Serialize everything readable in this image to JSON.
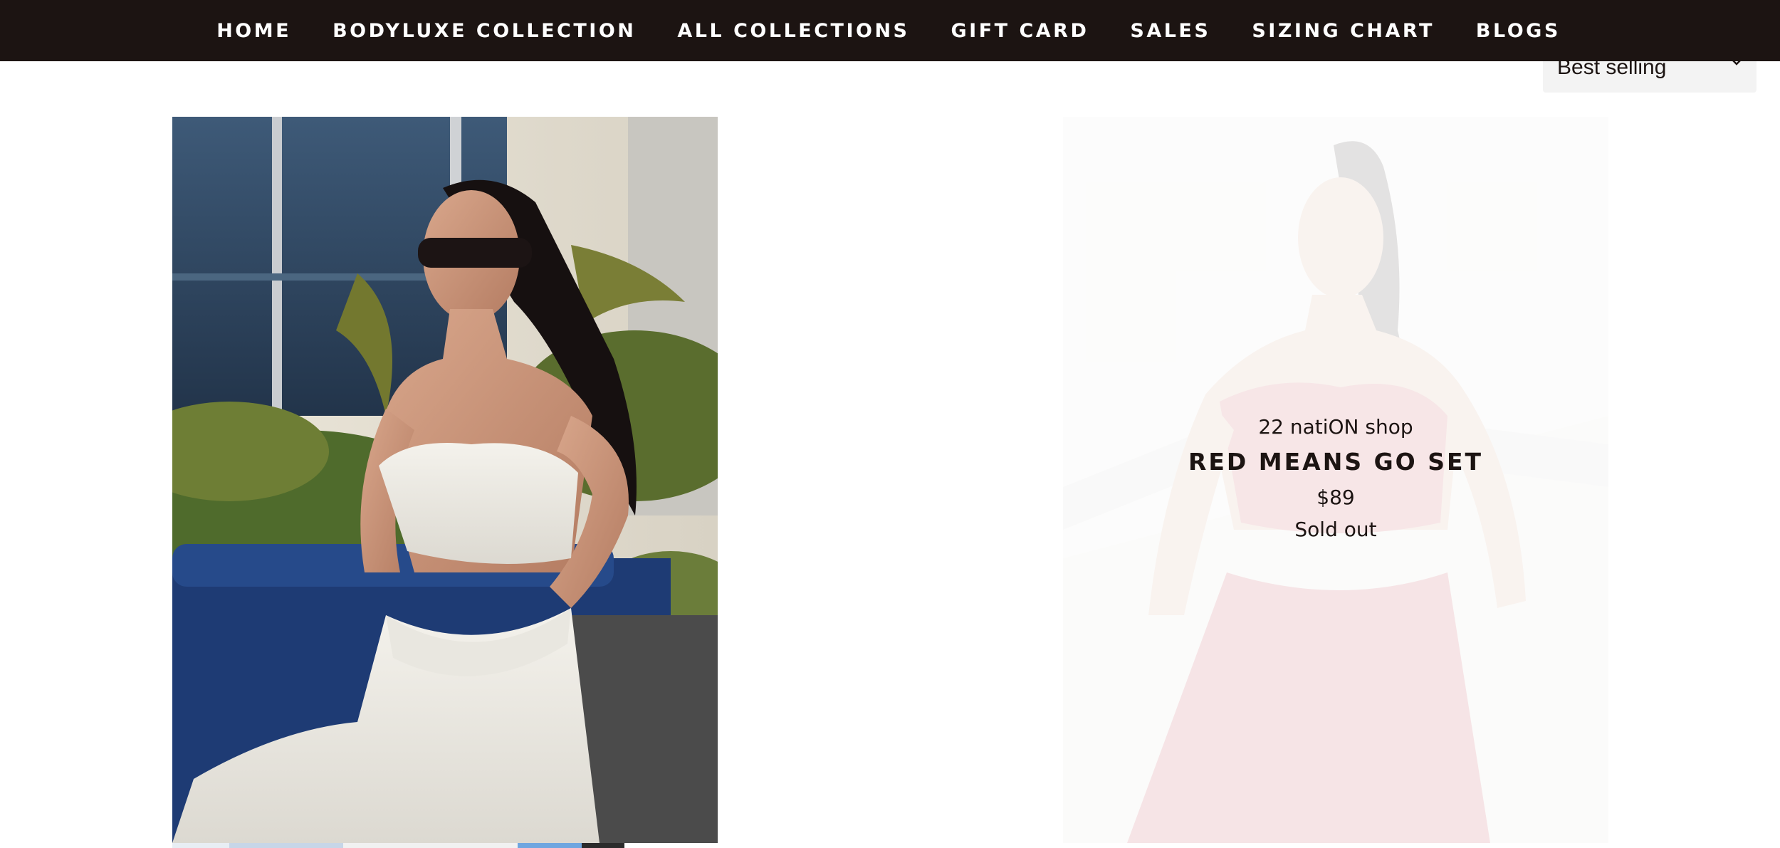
{
  "nav": {
    "items": [
      {
        "label": "HOME"
      },
      {
        "label": "BODYLUXE COLLECTION"
      },
      {
        "label": "ALL COLLECTIONS"
      },
      {
        "label": "GIFT CARD"
      },
      {
        "label": "SALES"
      },
      {
        "label": "SIZING CHART"
      },
      {
        "label": "BLOGS"
      }
    ]
  },
  "sort": {
    "selected": "Best selling",
    "icon": "chevron-down-icon"
  },
  "products": [
    {
      "image_alt": "Model in white ribbed sports bra and leggings"
    },
    {
      "vendor": "22 natiON shop",
      "title": "RED MEANS GO SET",
      "price": "$89",
      "status": "Sold out",
      "image_alt": "Model in red set"
    }
  ],
  "colors": {
    "nav_bg": "#1c1412",
    "nav_text": "#ffffff",
    "text": "#1c1412",
    "select_bg": "#f3f3f3"
  }
}
